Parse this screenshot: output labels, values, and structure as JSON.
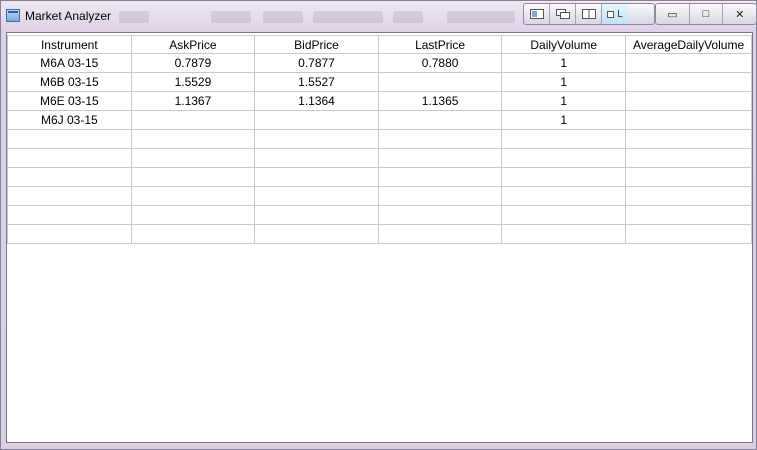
{
  "window": {
    "title": "Market Analyzer"
  },
  "toolbar": {
    "buttons": [
      {
        "icon": "window-layout-icon"
      },
      {
        "icon": "cascade-icon"
      },
      {
        "icon": "tile-icon"
      },
      {
        "icon": "link-icon",
        "label": "L"
      }
    ]
  },
  "system_buttons": {
    "minimize": "▭",
    "maximize": "□",
    "close": "✕"
  },
  "table": {
    "columns": [
      "Instrument",
      "AskPrice",
      "BidPrice",
      "LastPrice",
      "DailyVolume",
      "AverageDailyVolume"
    ],
    "rows": [
      [
        "M6A 03-15",
        "0.7879",
        "0.7877",
        "0.7880",
        "1",
        ""
      ],
      [
        "M6B 03-15",
        "1.5529",
        "1.5527",
        "",
        "1",
        ""
      ],
      [
        "M6E 03-15",
        "1.1367",
        "1.1364",
        "1.1365",
        "1",
        ""
      ],
      [
        "M6J 03-15",
        "",
        "",
        "",
        "1",
        ""
      ],
      [
        "",
        "",
        "",
        "",
        "",
        ""
      ],
      [
        "",
        "",
        "",
        "",
        "",
        ""
      ],
      [
        "",
        "",
        "",
        "",
        "",
        ""
      ],
      [
        "",
        "",
        "",
        "",
        "",
        ""
      ],
      [
        "",
        "",
        "",
        "",
        "",
        ""
      ],
      [
        "",
        "",
        "",
        "",
        "",
        ""
      ]
    ]
  }
}
